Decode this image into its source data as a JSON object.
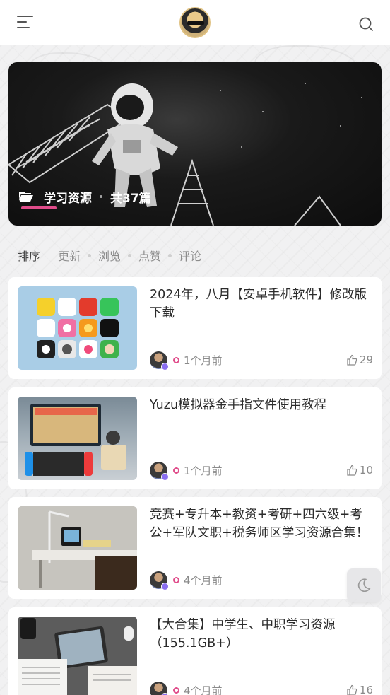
{
  "header": {
    "menu_icon": "menu-icon",
    "avatar_icon": "avatar",
    "search_icon": "search-icon"
  },
  "hero": {
    "folder_icon": "folder-open-icon",
    "category": "学习资源",
    "count_text": "共37篇",
    "accent_color": "#e04c8a"
  },
  "sort": {
    "label": "排序",
    "options": [
      "更新",
      "浏览",
      "点赞",
      "评论"
    ]
  },
  "posts": [
    {
      "title": "2024年，八月【安卓手机软件】修改版 下载",
      "time": "1个月前",
      "likes": "29"
    },
    {
      "title": "Yuzu模拟器金手指文件使用教程",
      "time": "1个月前",
      "likes": "10"
    },
    {
      "title": "竞赛+专升本+教资+考研+四六级+考公+军队文职+税务师区学习资源合集！",
      "time": "4个月前",
      "likes": ""
    },
    {
      "title": "【大合集】中学生、中职学习资源（155.1GB+）",
      "time": "4个月前",
      "likes": "16"
    }
  ],
  "theme_toggle_icon": "moon-icon"
}
